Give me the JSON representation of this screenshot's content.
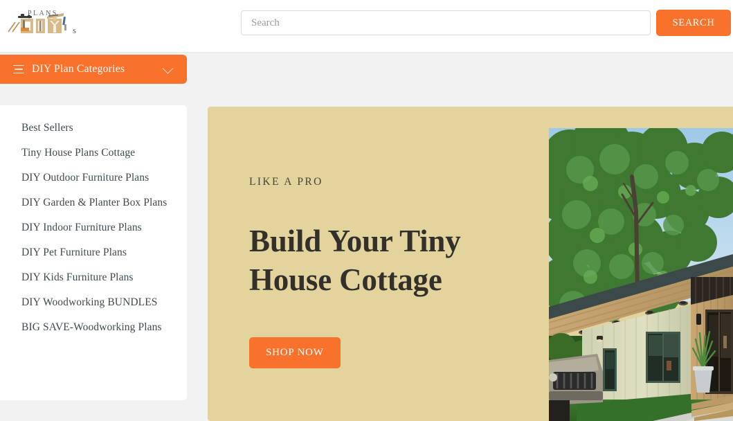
{
  "header": {
    "logo": {
      "name": "plans-diys-logo",
      "top_text": "PLANS",
      "main_text": "DIY",
      "suffix_text": "s"
    },
    "search": {
      "placeholder": "Search",
      "value": "",
      "button_label": "SEARCH"
    }
  },
  "category_bar": {
    "label": "DIY Plan Categories",
    "menu_icon": "hamburger-icon",
    "chevron_icon": "chevron-down-icon"
  },
  "sidebar": {
    "items": [
      {
        "label": "Best Sellers"
      },
      {
        "label": "Tiny House Plans Cottage"
      },
      {
        "label": "DIY Outdoor Furniture Plans"
      },
      {
        "label": "DIY Garden & Planter Box Plans"
      },
      {
        "label": "DIY Indoor Furniture Plans"
      },
      {
        "label": "DIY Pet Furniture Plans"
      },
      {
        "label": "DIY Kids Furniture Plans"
      },
      {
        "label": "DIY Woodworking BUNDLES"
      },
      {
        "label": "BIG SAVE-Woodworking Plans"
      }
    ]
  },
  "hero": {
    "eyebrow": "LIKE A PRO",
    "title": "Build Your Tiny House Cottage",
    "cta_label": "SHOP NOW",
    "image_alt": "Modern wooden tiny house cottage with trees, lawn, vehicle and deck stairs"
  },
  "colors": {
    "accent_orange": "#f8722c",
    "hero_background": "#e3d49d",
    "page_background": "#f2f2f2",
    "card_white": "#ffffff",
    "text_dark": "#33302b",
    "sidebar_text": "#3f4a4f"
  }
}
